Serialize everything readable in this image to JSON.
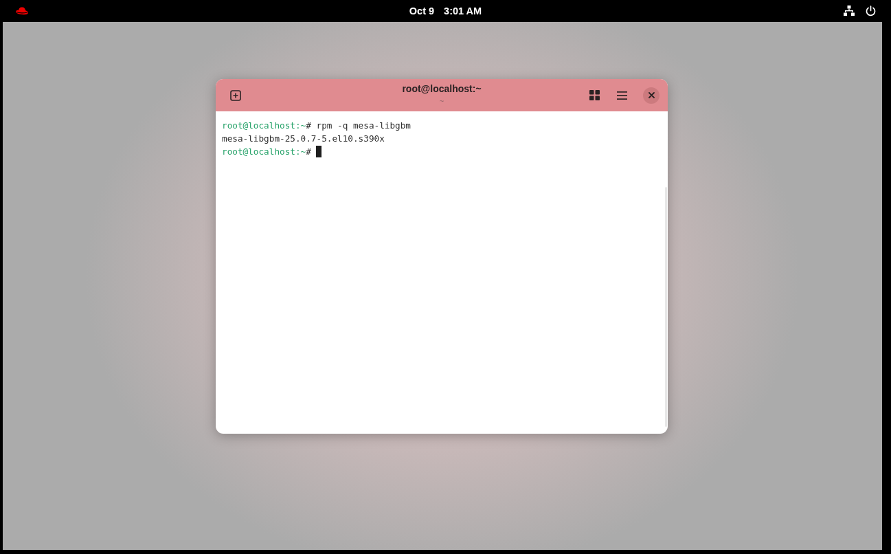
{
  "top_bar": {
    "date": "Oct 9",
    "time": "3:01 AM"
  },
  "terminal": {
    "title": "root@localhost:~",
    "subtitle": "~",
    "lines": [
      {
        "kind": "prompt",
        "host": "root@localhost:~",
        "sign": "#",
        "command": "rpm -q mesa-libgbm",
        "cursor": false
      },
      {
        "kind": "output",
        "text": "mesa-libgbm-25.0.7-5.el10.s390x"
      },
      {
        "kind": "prompt",
        "host": "root@localhost:~",
        "sign": "#",
        "cursor": true
      }
    ]
  }
}
